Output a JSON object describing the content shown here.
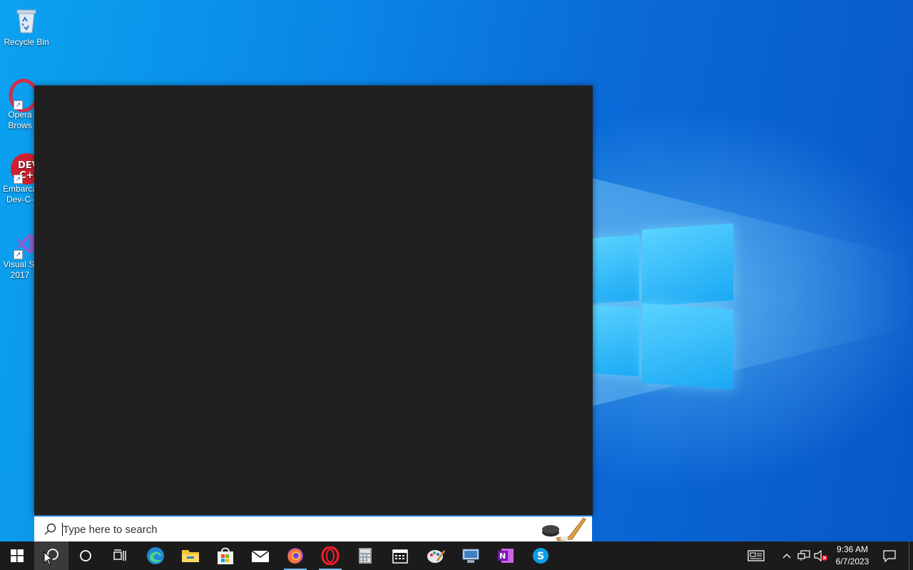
{
  "desktop": {
    "icons": [
      {
        "label": "Recycle Bin",
        "icon": "recycle-bin-icon"
      },
      {
        "label": "Opera\nBrows",
        "icon": "opera-icon"
      },
      {
        "label": "Embarca\nDev-C-",
        "icon": "dev-cpp-icon"
      },
      {
        "label": "Visual St\n2017",
        "icon": "visual-studio-icon"
      }
    ]
  },
  "search": {
    "placeholder": "Type here to search"
  },
  "taskbar": {
    "items": [
      {
        "name": "start",
        "icon": "windows-start-icon"
      },
      {
        "name": "search",
        "icon": "search-icon"
      },
      {
        "name": "cortana",
        "icon": "cortana-icon"
      },
      {
        "name": "task-view",
        "icon": "task-view-icon"
      },
      {
        "name": "edge",
        "icon": "edge-icon"
      },
      {
        "name": "file-explorer",
        "icon": "folder-icon"
      },
      {
        "name": "store",
        "icon": "store-icon"
      },
      {
        "name": "mail",
        "icon": "mail-icon"
      },
      {
        "name": "firefox",
        "icon": "firefox-icon"
      },
      {
        "name": "opera",
        "icon": "opera-icon"
      },
      {
        "name": "calculator",
        "icon": "calculator-icon"
      },
      {
        "name": "calendar",
        "icon": "calendar-icon"
      },
      {
        "name": "paint",
        "icon": "paint-icon"
      },
      {
        "name": "network-app",
        "icon": "network-app-icon"
      },
      {
        "name": "onenote",
        "icon": "onenote-icon"
      },
      {
        "name": "skype",
        "icon": "skype-icon"
      }
    ]
  },
  "tray": {
    "time": "9:36 AM",
    "date": "6/7/2023"
  },
  "colors": {
    "accent": "#2b7cd3",
    "taskbar": "#1b1b1b",
    "start_panel": "#202020"
  }
}
